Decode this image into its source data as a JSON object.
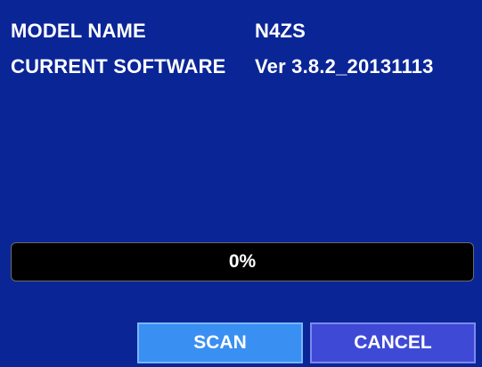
{
  "info": {
    "model_label": "MODEL NAME",
    "model_value": "N4ZS",
    "software_label": "CURRENT SOFTWARE",
    "software_value": "Ver 3.8.2_20131113"
  },
  "progress": {
    "percent": 0,
    "text": "0%"
  },
  "buttons": {
    "scan_label": "SCAN",
    "cancel_label": "CANCEL"
  },
  "colors": {
    "background": "#0a2596",
    "scan_button": "#3a8ff2",
    "cancel_button": "#3e4ad6",
    "progress_track": "#000000"
  }
}
